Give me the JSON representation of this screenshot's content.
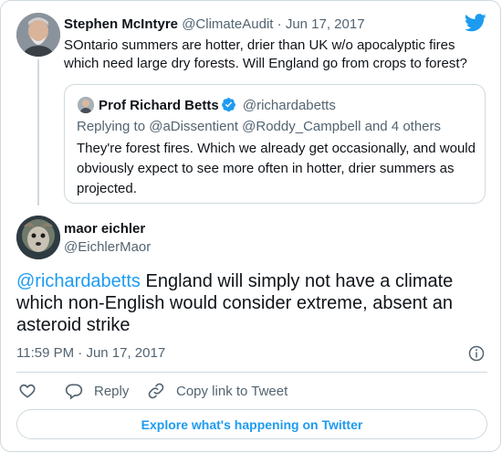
{
  "tweet_quoted_parent": {
    "author_name": "Stephen McIntyre",
    "author_handle": "@ClimateAudit",
    "separator": "·",
    "date": "Jun 17, 2017",
    "text": "SOntario summers are hotter, drier than UK w/o apocalyptic fires which need large dry forests. Will England go from crops to forest?"
  },
  "quote": {
    "author_name": "Prof Richard Betts",
    "author_handle": "@richardabetts",
    "replying_prefix": "Replying to",
    "replying_to": "@aDissentient @Roddy_Campbell and 4 others",
    "text": "They're forest fires. Which we already get occasionally, and would obviously expect to see more often in hotter, drier summers as projected."
  },
  "tweet": {
    "author_name": "maor eichler",
    "author_handle": "@EichlerMaor",
    "mention": "@richardabetts",
    "text": " England will simply not have a climate which non-English would consider extreme, absent an asteroid strike",
    "time": "11:59 PM",
    "separator": "·",
    "date": "Jun 17, 2017"
  },
  "actions": {
    "like_count": "",
    "reply_label": "Reply",
    "copy_label": "Copy link to Tweet"
  },
  "explore_label": "Explore what's happening on Twitter",
  "icons": [
    "twitter-bird-icon",
    "verified-icon",
    "info-icon",
    "heart-icon",
    "reply-icon",
    "link-icon"
  ],
  "colors": {
    "accent": "#1d9bf0",
    "text": "#0f1419",
    "muted": "#536471",
    "border": "#cfd9de"
  }
}
